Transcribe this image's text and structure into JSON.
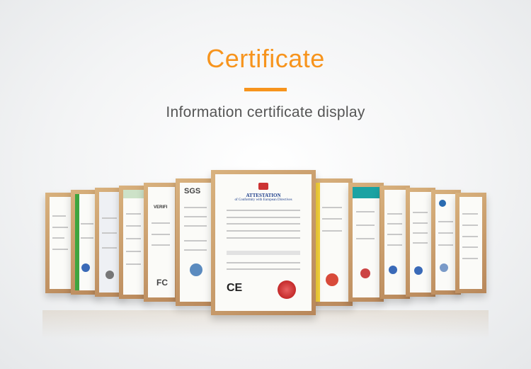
{
  "header": {
    "title": "Certificate",
    "subtitle": "Information certificate display",
    "accent_color": "#f7941d"
  },
  "certificates": {
    "main": {
      "heading": "ATTESTATION",
      "subheading": "of Conformity with European Directives",
      "mark": "CE"
    },
    "sgs_mark": "SGS",
    "verify_mark": "VERIFI",
    "fc_mark": "FC"
  }
}
